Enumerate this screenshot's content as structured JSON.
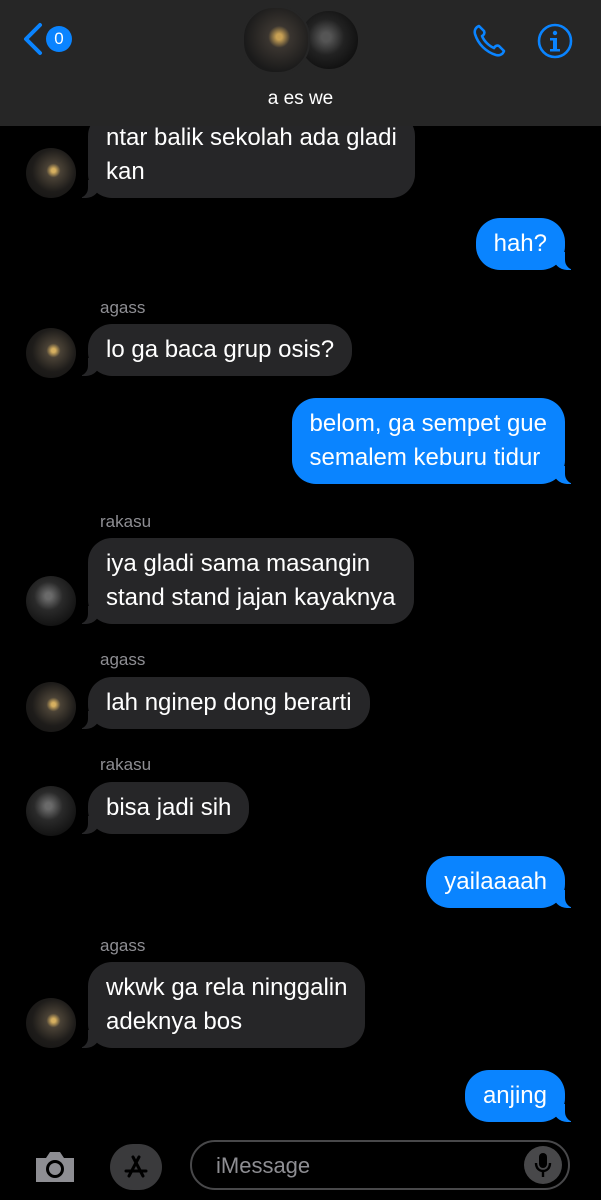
{
  "header": {
    "unread_count": "0",
    "group_name": "a es we",
    "accent_color": "#0a84ff"
  },
  "messages": [
    {
      "from": "agass",
      "dir": "in",
      "text": "ntar balik sekolah ada gladi\nkan"
    },
    {
      "dir": "out",
      "text": "hah?"
    },
    {
      "sender_label": "agass",
      "from": "agass",
      "dir": "in",
      "text": "lo ga baca grup osis?"
    },
    {
      "dir": "out",
      "text": "belom, ga sempet gue\nsemalem keburu tidur"
    },
    {
      "sender_label": "rakasu",
      "from": "rakasu",
      "dir": "in",
      "text": "iya gladi sama masangin\nstand stand jajan kayaknya"
    },
    {
      "sender_label": "agass",
      "from": "agass",
      "dir": "in",
      "text": "lah nginep dong berarti"
    },
    {
      "sender_label": "rakasu",
      "from": "rakasu",
      "dir": "in",
      "text": "bisa jadi sih"
    },
    {
      "dir": "out",
      "text": "yailaaaah"
    },
    {
      "sender_label": "agass",
      "from": "agass",
      "dir": "in",
      "text": "wkwk ga rela ninggalin\nadeknya bos"
    },
    {
      "dir": "out",
      "text": "anjing"
    }
  ],
  "input": {
    "placeholder": "iMessage",
    "value": ""
  },
  "icons": {
    "back": "chevron-left-icon",
    "call": "phone-icon",
    "info": "info-icon",
    "camera": "camera-icon",
    "apps": "app-store-icon",
    "mic": "microphone-icon"
  }
}
